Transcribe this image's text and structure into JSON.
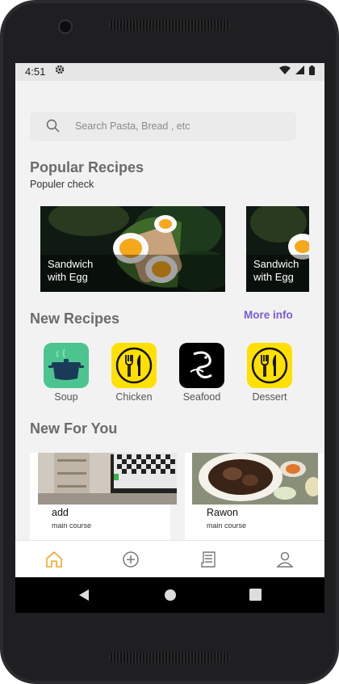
{
  "status_bar": {
    "time": "4:51",
    "icons": [
      "gear-icon",
      "wifi-icon",
      "signal-icon",
      "battery-icon"
    ]
  },
  "search": {
    "placeholder": "Search Pasta, Bread , etc"
  },
  "popular": {
    "title": "Popular Recipes",
    "subtitle": "Populer check",
    "cards": [
      {
        "label": "Sandwich\nwith Egg"
      },
      {
        "label": "Sandwich\nwith Egg"
      }
    ]
  },
  "new_recipes": {
    "title": "New Recipes",
    "more_label": "More info",
    "categories": [
      {
        "label": "Soup",
        "icon": "soup-pot-icon",
        "bg": "#4cc48f"
      },
      {
        "label": "Chicken",
        "icon": "fork-knife-icon",
        "bg": "#ffe000"
      },
      {
        "label": "Seafood",
        "icon": "seafood-icon",
        "bg": "#000000"
      },
      {
        "label": "Dessert",
        "icon": "fork-knife-icon",
        "bg": "#ffe000"
      }
    ]
  },
  "new_for_you": {
    "title": "New For You",
    "items": [
      {
        "title": "add",
        "category": "main course"
      },
      {
        "title": "Rawon",
        "category": "main course"
      }
    ]
  },
  "bottom_nav": {
    "items": [
      "home-icon",
      "add-icon",
      "receipt-icon",
      "profile-icon"
    ],
    "active_color": "#f5a623"
  },
  "accent": "#7a5cd6"
}
